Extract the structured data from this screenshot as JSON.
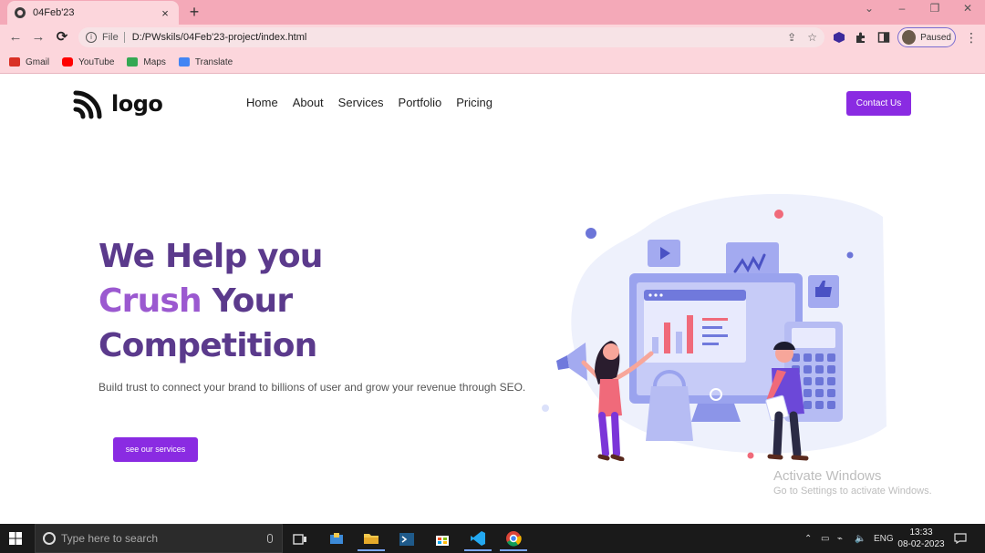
{
  "browser": {
    "tab": {
      "title": "04Feb'23",
      "favicon": "globe-icon",
      "close": "×"
    },
    "new_tab": "+",
    "window_controls": {
      "minimize": "–",
      "restore": "❐",
      "close": "✕",
      "tab_search": "⌄"
    },
    "toolbar": {
      "back": "←",
      "forward": "→",
      "reload": "⟳",
      "scheme_label": "File",
      "url": "D:/PWskils/04Feb'23-project/index.html",
      "share": "⇪",
      "star": "☆"
    },
    "profile_status": "Paused",
    "bookmarks": [
      {
        "label": "Gmail",
        "color": "#d93025"
      },
      {
        "label": "YouTube",
        "color": "#ff0000"
      },
      {
        "label": "Maps",
        "color": "#34a853"
      },
      {
        "label": "Translate",
        "color": "#4285f4"
      }
    ]
  },
  "site": {
    "logo_text": "logo",
    "nav": [
      "Home",
      "About",
      "Services",
      "Portfolio",
      "Pricing"
    ],
    "contact_label": "Contact Us",
    "hero": {
      "line1": "We Help you",
      "accent": "Crush",
      "line2_rest": " Your",
      "line3": "Competition",
      "subtitle": "Build trust to connect your brand to billions of user and grow your revenue through SEO.",
      "cta_label": "see our services"
    },
    "colors": {
      "primary": "#8a2be2",
      "heading": "#5b3a8c",
      "accent": "#9b59d0"
    }
  },
  "watermark": {
    "line1": "Activate Windows",
    "line2": "Go to Settings to activate Windows."
  },
  "taskbar": {
    "search_placeholder": "Type here to search",
    "apps": [
      "task-view-icon",
      "folder-icon",
      "explorer-icon",
      "terminal-icon",
      "store-icon",
      "vscode-icon",
      "chrome-icon"
    ],
    "tray_lang": "ENG",
    "time": "13:33",
    "date": "08-02-2023"
  }
}
